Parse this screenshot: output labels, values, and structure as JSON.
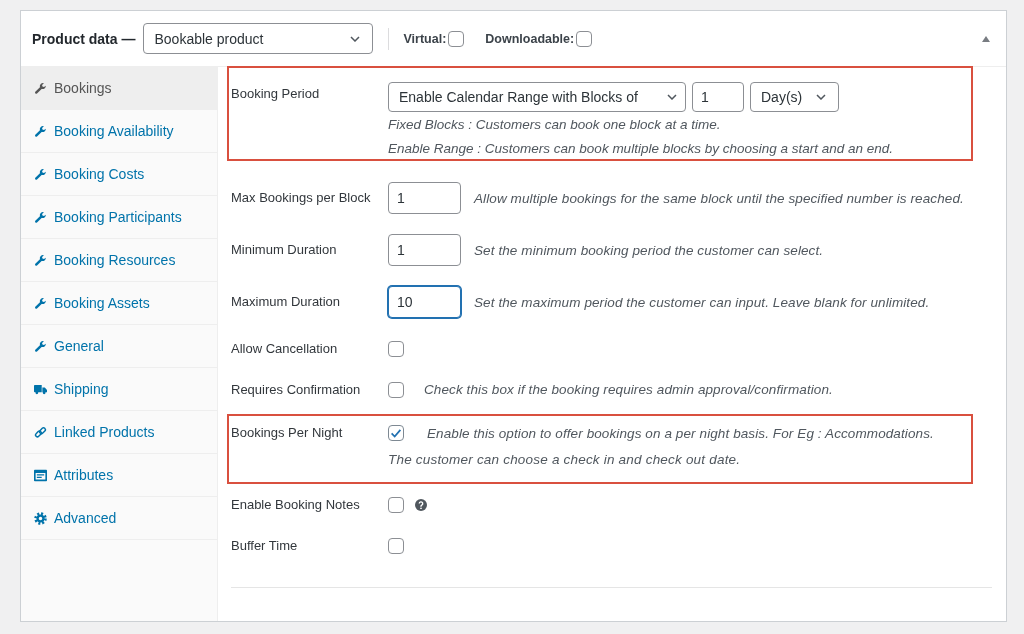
{
  "panel": {
    "title": "Product data —",
    "product_type": "Bookable product",
    "options": [
      {
        "label": "Virtual:",
        "checked": false
      },
      {
        "label": "Downloadable:",
        "checked": false
      }
    ]
  },
  "tabs": [
    {
      "label": "Bookings",
      "selected": true
    },
    {
      "label": "Booking Availability",
      "selected": false
    },
    {
      "label": "Booking Costs",
      "selected": false
    },
    {
      "label": "Booking Participants",
      "selected": false
    },
    {
      "label": "Booking Resources",
      "selected": false
    },
    {
      "label": "Booking Assets",
      "selected": false
    },
    {
      "label": "General",
      "selected": false
    },
    {
      "label": "Shipping",
      "selected": false
    },
    {
      "label": "Linked Products",
      "selected": false
    },
    {
      "label": "Attributes",
      "selected": false
    },
    {
      "label": "Advanced",
      "selected": false
    }
  ],
  "fields": [
    {
      "kind": "period",
      "label": "Booking Period",
      "highlighted": true,
      "select": "Enable Calendar Range with Blocks of",
      "value": "1",
      "unit": "Day(s)",
      "notes": [
        "Fixed Blocks : Customers can book one block at a time.",
        "Enable Range : Customers can book multiple blocks by choosing a start and an end."
      ]
    },
    {
      "kind": "number",
      "label": "Max Bookings per Block",
      "highlighted": false,
      "value": "1",
      "focused": false,
      "description": "Allow multiple bookings for the same block until the specified number is reached."
    },
    {
      "kind": "number",
      "label": "Minimum Duration",
      "highlighted": false,
      "value": "1",
      "focused": false,
      "description": "Set the minimum booking period the customer can select."
    },
    {
      "kind": "number",
      "label": "Maximum Duration",
      "highlighted": false,
      "value": "10",
      "focused": true,
      "description": "Set the maximum period the customer can input. Leave blank for unlimited."
    },
    {
      "kind": "checkbox",
      "label": "Allow Cancellation",
      "highlighted": false,
      "checked": false
    },
    {
      "kind": "checkbox",
      "label": "Requires Confirmation",
      "highlighted": false,
      "checked": false,
      "description": "Check this box if the booking requires admin approval/confirmation."
    },
    {
      "kind": "checkbox",
      "label": "Bookings Per Night",
      "highlighted": true,
      "checked": true,
      "description": "Enable this option to offer bookings on a per night basis. For Eg : Accommodations.",
      "note": "The customer can choose a check in and check out date."
    },
    {
      "kind": "checkbox",
      "label": "Enable Booking Notes",
      "highlighted": false,
      "checked": false,
      "help": true
    },
    {
      "kind": "checkbox",
      "label": "Buffer Time",
      "highlighted": false,
      "checked": false
    }
  ]
}
